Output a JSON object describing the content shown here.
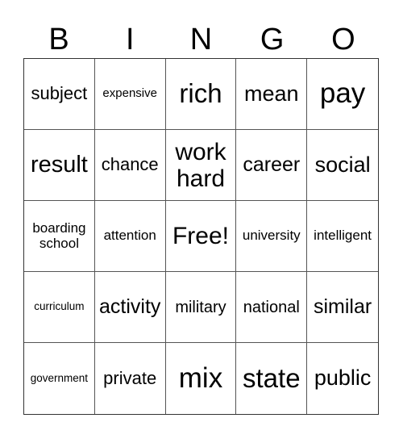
{
  "header": [
    "B",
    "I",
    "N",
    "G",
    "O"
  ],
  "cells": [
    "subject",
    "expensive",
    "rich",
    "mean",
    "pay",
    "result",
    "chance",
    "work hard",
    "career",
    "social",
    "boarding school",
    "attention",
    "Free!",
    "university",
    "intelligent",
    "curriculum",
    "activity",
    "military",
    "national",
    "similar",
    "government",
    "private",
    "mix",
    "state",
    "public"
  ]
}
